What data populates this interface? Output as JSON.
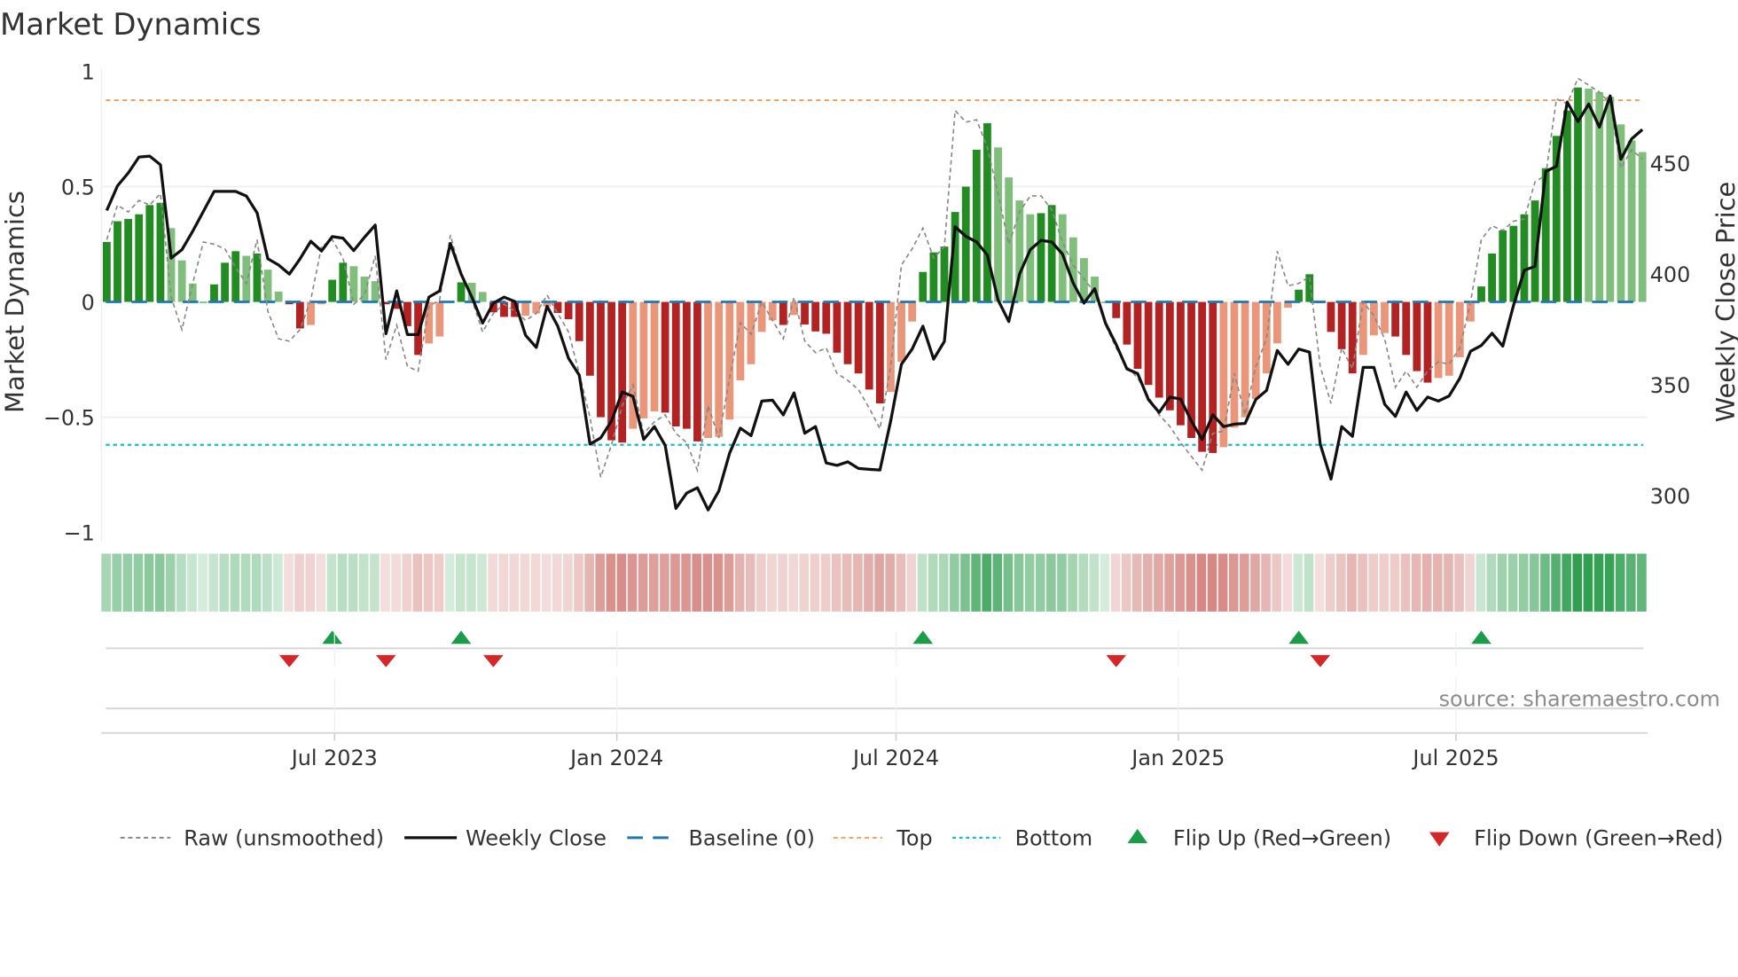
{
  "chart_data": {
    "type": "bar",
    "title": "Market Dynamics",
    "ylabel": "Market Dynamics",
    "y2label": "Weekly Close Price",
    "ylim": [
      -1,
      1
    ],
    "y2lim": [
      270,
      495
    ],
    "yticks": [
      {
        "value": 1,
        "label": "1"
      },
      {
        "value": 0.5,
        "label": "0.5"
      },
      {
        "value": 0,
        "label": "0"
      },
      {
        "value": -0.5,
        "label": "−0.5"
      },
      {
        "value": -1,
        "label": "−1"
      }
    ],
    "y2ticks": [
      {
        "value": 450,
        "label": "450"
      },
      {
        "value": 400,
        "label": "400"
      },
      {
        "value": 350,
        "label": "350"
      },
      {
        "value": 300,
        "label": "300"
      }
    ],
    "xticks": [
      {
        "date": "2023-07-01",
        "label": "Jul 2023"
      },
      {
        "date": "2024-01-01",
        "label": "Jan 2024"
      },
      {
        "date": "2024-07-01",
        "label": "Jul 2024"
      },
      {
        "date": "2025-01-01",
        "label": "Jan 2025"
      },
      {
        "date": "2025-07-01",
        "label": "Jul 2025"
      }
    ],
    "start_date": "2023-01-30",
    "frequency": "weekly",
    "grid": true,
    "reference_lines": {
      "baseline": 0,
      "top": 0.875,
      "bottom": -0.62
    },
    "dynamics": [
      0.26,
      0.35,
      0.36,
      0.38,
      0.42,
      0.43,
      0.32,
      0.18,
      0.08,
      0,
      0.076,
      0.17,
      0.22,
      0.2,
      0.21,
      0.14,
      0.045,
      -0.01,
      -0.115,
      -0.1,
      -0.01,
      0.096,
      0.17,
      0.155,
      0.11,
      0.09,
      -0.01,
      -0.03,
      -0.105,
      -0.23,
      -0.18,
      -0.15,
      0,
      0.085,
      0.083,
      0.043,
      -0.045,
      -0.065,
      -0.065,
      -0.06,
      -0.05,
      -0.02,
      -0.048,
      -0.075,
      -0.17,
      -0.32,
      -0.5,
      -0.6,
      -0.61,
      -0.55,
      -0.505,
      -0.475,
      -0.48,
      -0.54,
      -0.55,
      -0.605,
      -0.59,
      -0.585,
      -0.51,
      -0.34,
      -0.27,
      -0.13,
      -0.08,
      -0.1,
      -0.057,
      -0.098,
      -0.128,
      -0.138,
      -0.22,
      -0.27,
      -0.31,
      -0.38,
      -0.44,
      -0.39,
      -0.26,
      -0.085,
      0.13,
      0.215,
      0.24,
      0.39,
      0.5,
      0.66,
      0.775,
      0.67,
      0.54,
      0.44,
      0.38,
      0.385,
      0.42,
      0.38,
      0.28,
      0.19,
      0.11,
      0,
      -0.07,
      -0.185,
      -0.29,
      -0.36,
      -0.415,
      -0.47,
      -0.535,
      -0.59,
      -0.65,
      -0.655,
      -0.63,
      -0.545,
      -0.5,
      -0.42,
      -0.31,
      -0.18,
      -0.025,
      0.053,
      0.12,
      -0.005,
      -0.13,
      -0.205,
      -0.31,
      -0.23,
      -0.145,
      -0.135,
      -0.15,
      -0.23,
      -0.3,
      -0.35,
      -0.33,
      -0.32,
      -0.24,
      -0.085,
      0.067,
      0.21,
      0.31,
      0.33,
      0.38,
      0.44,
      0.58,
      0.72,
      0.83,
      0.93,
      0.925,
      0.91,
      0.89,
      0.77,
      0.7,
      0.65
    ],
    "raw": [
      0.27,
      0.42,
      0.39,
      0.44,
      0.42,
      0.47,
      0.02,
      -0.12,
      0.08,
      0.26,
      0.25,
      0.23,
      0.15,
      0.08,
      0.27,
      -0.04,
      -0.16,
      -0.17,
      -0.12,
      0.01,
      0.24,
      0.27,
      0.19,
      -0.01,
      0.03,
      0.2,
      -0.25,
      -0.1,
      -0.28,
      -0.3,
      -0.02,
      0.01,
      0.29,
      0.12,
      0.01,
      -0.13,
      -0.05,
      -0.01,
      -0.04,
      -0.08,
      -0.05,
      0.03,
      -0.05,
      -0.13,
      -0.31,
      -0.5,
      -0.76,
      -0.62,
      -0.45,
      -0.36,
      -0.57,
      -0.52,
      -0.49,
      -0.57,
      -0.61,
      -0.73,
      -0.45,
      -0.59,
      -0.33,
      -0.09,
      -0.14,
      0,
      -0.08,
      -0.16,
      0.02,
      -0.17,
      -0.22,
      -0.2,
      -0.31,
      -0.34,
      -0.38,
      -0.46,
      -0.55,
      -0.28,
      0.16,
      0.23,
      0.32,
      0.19,
      0.24,
      0.83,
      0.78,
      0.79,
      0.67,
      0.47,
      0.25,
      0.39,
      0.46,
      0.46,
      0.4,
      0.26,
      0.16,
      0.1,
      0.04,
      -0.1,
      -0.2,
      -0.28,
      -0.33,
      -0.41,
      -0.49,
      -0.54,
      -0.61,
      -0.67,
      -0.73,
      -0.57,
      -0.56,
      -0.31,
      -0.49,
      -0.28,
      -0.16,
      0.22,
      0.07,
      0.08,
      0.11,
      -0.28,
      -0.44,
      -0.2,
      -0.29,
      0,
      -0.06,
      -0.16,
      -0.37,
      -0.3,
      -0.37,
      -0.3,
      -0.26,
      -0.27,
      -0.2,
      0.0,
      0.27,
      0.33,
      0.31,
      0.35,
      0.36,
      0.52,
      0.55,
      0.88,
      0.86,
      0.97,
      0.94,
      0.91,
      0.86,
      0.58,
      0.66,
      0.62
    ],
    "weekly_close": [
      428.7,
      439.8,
      445.6,
      452.8,
      453.2,
      449.3,
      407.2,
      411,
      419.3,
      428.3,
      437.3,
      437.3,
      437.3,
      435.2,
      427.6,
      406.9,
      404.1,
      400,
      406.9,
      414.8,
      410.4,
      416.9,
      416.2,
      410.6,
      416.6,
      422.1,
      373.1,
      392.4,
      372.7,
      372.7,
      389.6,
      392.4,
      413.8,
      400,
      389.6,
      377.9,
      386.9,
      389.6,
      387.6,
      372.4,
      366.9,
      385.5,
      376.5,
      362,
      354.4,
      323.3,
      326.1,
      333.7,
      346.8,
      344.8,
      325.4,
      331.2,
      322.7,
      294.3,
      301.2,
      303.6,
      293.6,
      302.2,
      319.2,
      330.5,
      327.1,
      342.7,
      343.1,
      336.5,
      346.4,
      328.2,
      331.2,
      314.8,
      313.7,
      315.3,
      312.3,
      311.9,
      311.6,
      333.7,
      359.3,
      366.2,
      376.5,
      361.6,
      369.6,
      421.4,
      417,
      414.5,
      408.6,
      388.3,
      378.6,
      400,
      411,
      415.2,
      414.5,
      409,
      395.9,
      386.9,
      393.4,
      377.9,
      368.2,
      357.2,
      355.1,
      343.4,
      337.6,
      344.5,
      343.6,
      333.7,
      325.4,
      336.5,
      331.2,
      332.3,
      332.6,
      343.4,
      347.5,
      365.5,
      359.3,
      366.2,
      364.8,
      323.3,
      307.5,
      331.2,
      326.8,
      357.9,
      357.9,
      341.3,
      335.8,
      346.8,
      338.5,
      344.5,
      342.7,
      345,
      353,
      365.2,
      367.8,
      373.3,
      367.5,
      385.9,
      401.7,
      403.5,
      446.3,
      448.6,
      477.6,
      468.8,
      476.7,
      466.3,
      480.4,
      451.8,
      461,
      465.2
    ],
    "flip_up_weeks": [
      21,
      33,
      76,
      111,
      128
    ],
    "flip_down_weeks": [
      17,
      26,
      36,
      94,
      113
    ],
    "legend": {
      "placement": "bottom",
      "raw": "Raw (unsmoothed)",
      "close": "Weekly Close",
      "baseline": "Baseline (0)",
      "top": "Top",
      "bottom": "Bottom",
      "flip_up": "Flip Up (Red→Green)",
      "flip_down": "Flip Down (Green→Red)"
    },
    "source": "source: sharemaestro.com",
    "colors": {
      "pos_strong": "#228b22",
      "pos_weak": "#7fbf7b",
      "neg_strong": "#b22222",
      "neg_weak": "#e9967a",
      "baseline": "#1f77b4",
      "top": "#f4a261",
      "bottom": "#17becf",
      "raw": "#888888",
      "close": "#111111",
      "flip_up": "#1a9c48",
      "flip_down": "#d62728",
      "heat_pos": "#2e9e4f",
      "heat_neg": "#c8625c"
    }
  }
}
